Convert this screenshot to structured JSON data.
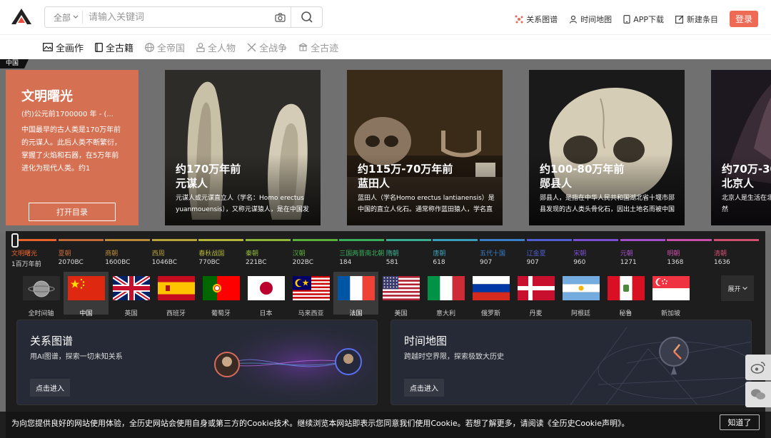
{
  "header": {
    "search_category": "全部",
    "search_placeholder": "请输入关键词",
    "nav": [
      "关系图谱",
      "时间地图",
      "APP下载",
      "新建条目"
    ],
    "login_label": "登录"
  },
  "subnav": [
    {
      "label": "全画作",
      "icon": "painting-icon",
      "active": true
    },
    {
      "label": "全古籍",
      "icon": "book-icon",
      "active": true
    },
    {
      "label": "全帝国",
      "icon": "globe-icon",
      "active": false
    },
    {
      "label": "全人物",
      "icon": "person-icon",
      "active": false
    },
    {
      "label": "全战争",
      "icon": "swords-icon",
      "active": false
    },
    {
      "label": "全古迹",
      "icon": "landmark-icon",
      "active": false
    }
  ],
  "hero": {
    "region_tag": "中国",
    "intro": {
      "title": "文明曙光",
      "date": "(约)公元前1700000 年 - (...",
      "desc": "中国最早的古人类是170万年前的元谋人。此后人类不断繁衍，掌握了火焰和石器，在5万年前进化为现代人类。约1",
      "open_label": "打开目录"
    },
    "cards": [
      {
        "date": "约170万年前",
        "name": "元谋人",
        "desc": "元谋人或元谋直立人（学名：Homo erectus yuanmouensis），又称元谋猿人，是在中国发"
      },
      {
        "date": "约115万-70万年前",
        "name": "蓝田人",
        "desc": "蓝田人（学名Homo erectus lantianensis）是中国的直立人化石。通常称作蓝田猿人，学名直"
      },
      {
        "date": "约100-80万年前",
        "name": "郧县人",
        "desc": "郧县人，是指在中华人民共和国湖北省十堰市郧县发现的古人类头骨化石，因出土地名而被中国"
      },
      {
        "date": "约70万-30",
        "name": "北京人",
        "desc": "北京人是生活在北京周口店的直立人，会使用天然"
      }
    ]
  },
  "timeline": {
    "eras": [
      {
        "name": "文明曙光",
        "year": "1百万年前",
        "color": "#e8622c"
      },
      {
        "name": "夏朝",
        "year": "2070BC",
        "color": "#c46a3a"
      },
      {
        "name": "商朝",
        "year": "1600BC",
        "color": "#b98a3a"
      },
      {
        "name": "西周",
        "year": "1046BC",
        "color": "#b8a23a"
      },
      {
        "name": "春秋战国",
        "year": "770BC",
        "color": "#b5b63a"
      },
      {
        "name": "秦朝",
        "year": "221BC",
        "color": "#8fb63a"
      },
      {
        "name": "汉朝",
        "year": "202BC",
        "color": "#5bb03a"
      },
      {
        "name": "三国两晋南北朝",
        "year": "184",
        "color": "#3aad5c"
      },
      {
        "name": "隋朝",
        "year": "581",
        "color": "#3aad90"
      },
      {
        "name": "唐朝",
        "year": "618",
        "color": "#3a9fb8"
      },
      {
        "name": "五代十国",
        "year": "907",
        "color": "#3a80c8"
      },
      {
        "name": "辽金夏",
        "year": "907",
        "color": "#4e5ed0"
      },
      {
        "name": "宋朝",
        "year": "960",
        "color": "#7a4ed0"
      },
      {
        "name": "元朝",
        "year": "1271",
        "color": "#a44ec8"
      },
      {
        "name": "明朝",
        "year": "1368",
        "color": "#c84ea8"
      },
      {
        "name": "清朝",
        "year": "1636",
        "color": "#d04e70"
      }
    ]
  },
  "countries": [
    {
      "name": "全时间轴",
      "flag": "globe"
    },
    {
      "name": "中国",
      "flag": "cn",
      "active": true
    },
    {
      "name": "英国",
      "flag": "gb"
    },
    {
      "name": "西班牙",
      "flag": "es"
    },
    {
      "name": "葡萄牙",
      "flag": "pt"
    },
    {
      "name": "日本",
      "flag": "jp"
    },
    {
      "name": "马来西亚",
      "flag": "my"
    },
    {
      "name": "法国",
      "flag": "fr",
      "hover": true
    },
    {
      "name": "美国",
      "flag": "us"
    },
    {
      "name": "意大利",
      "flag": "it"
    },
    {
      "name": "俄罗斯",
      "flag": "ru"
    },
    {
      "name": "丹麦",
      "flag": "dk"
    },
    {
      "name": "阿根廷",
      "flag": "ar"
    },
    {
      "name": "秘鲁",
      "flag": "pe"
    },
    {
      "name": "新加坡",
      "flag": "sg"
    }
  ],
  "expand_label": "展开",
  "features": [
    {
      "title": "关系图谱",
      "sub": "用AI图谱，探索一切未知关系",
      "btn": "点击进入"
    },
    {
      "title": "时间地图",
      "sub": "跨越时空界限，探索极致大历史",
      "btn": "点击进入"
    }
  ],
  "side_icons": [
    "weibo-icon",
    "wechat-icon"
  ],
  "cookie": {
    "text": "为向您提供良好的网站使用体验，全历史网站会使用自身或第三方的Cookie技术。继续浏览本网站即表示您同意我们使用Cookie。若想了解更多，请阅读《全历史Cookie声明》。",
    "btn": "知道了"
  }
}
